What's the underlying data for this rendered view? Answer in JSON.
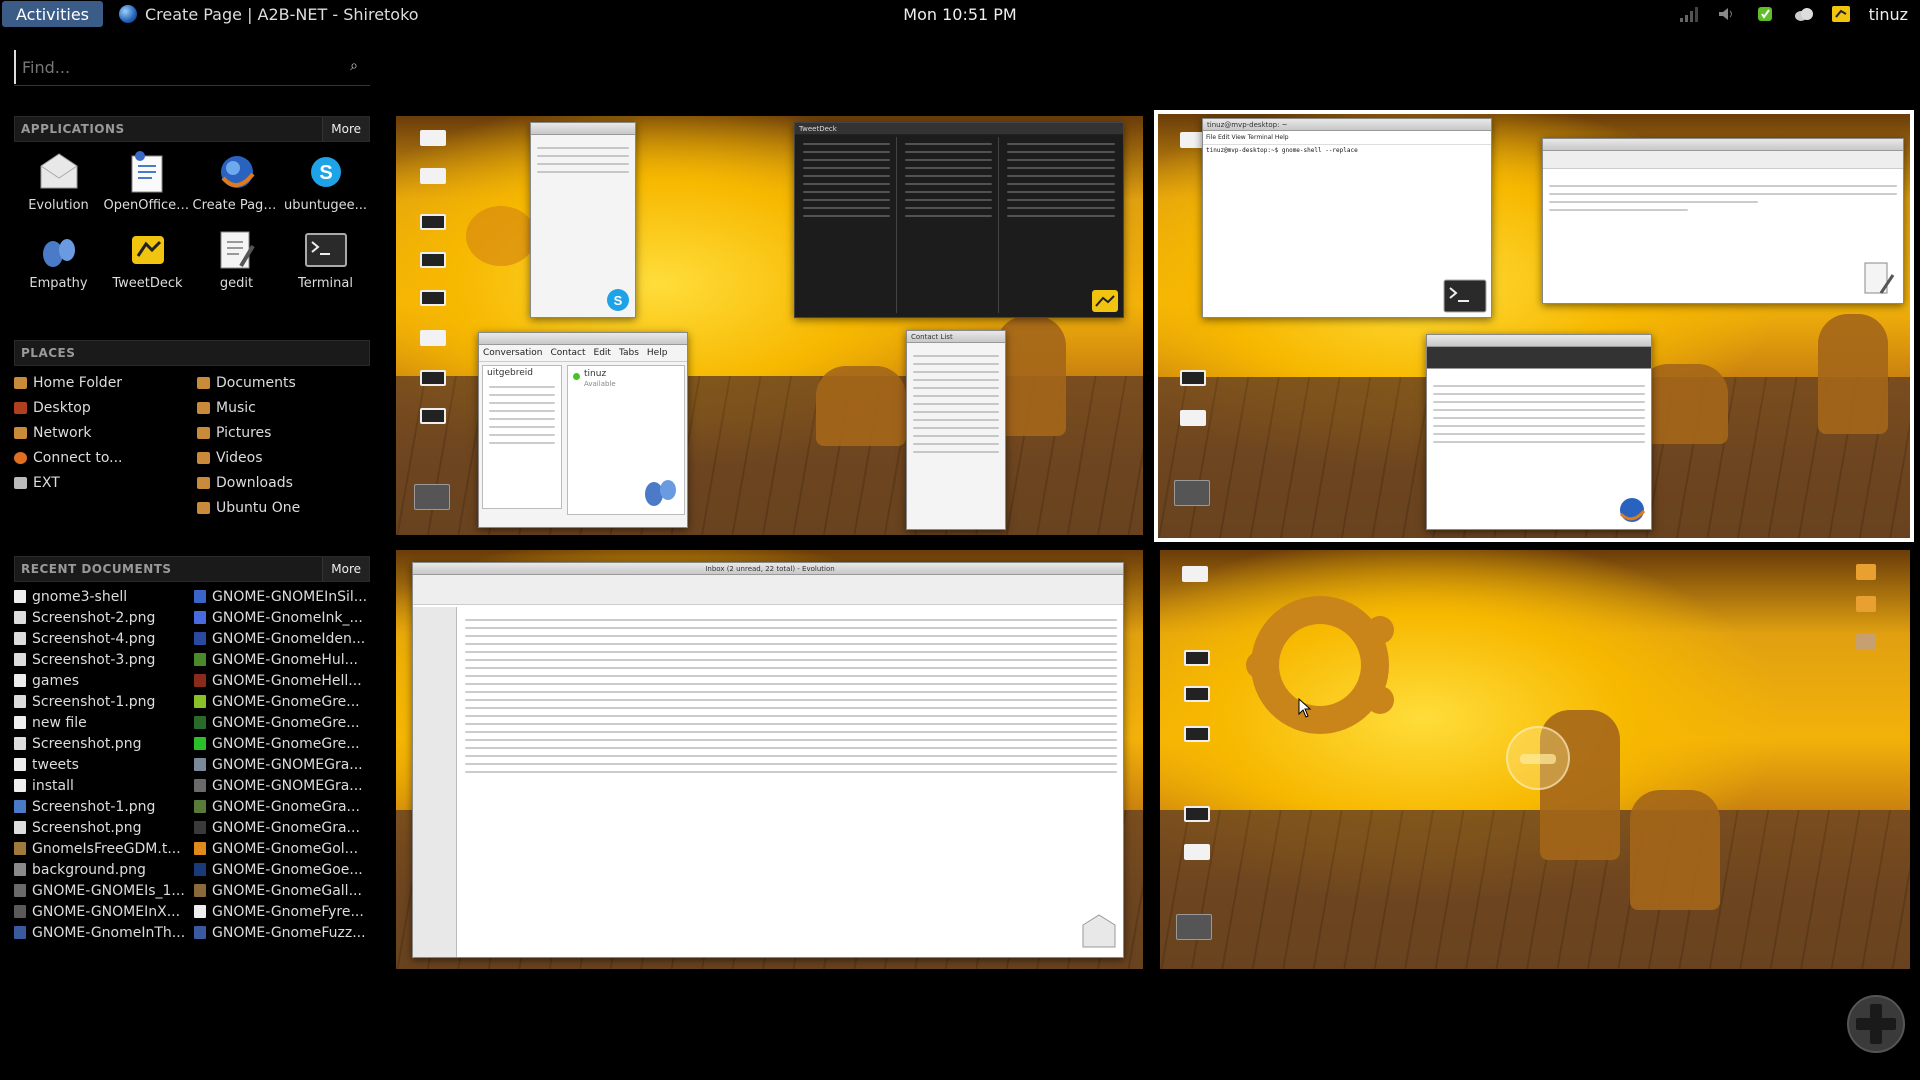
{
  "panel": {
    "activities": "Activities",
    "app_title": "Create Page | A2B-NET - Shiretoko",
    "clock": "Mon 10:51 PM",
    "user": "tinuz"
  },
  "search": {
    "placeholder": "Find..."
  },
  "applications": {
    "header": "APPLICATIONS",
    "more": "More",
    "items": [
      {
        "label": "Evolution",
        "icon": "evolution-icon"
      },
      {
        "label": "OpenOffice....",
        "icon": "openoffice-icon"
      },
      {
        "label": "Create Page...",
        "icon": "firefox-icon"
      },
      {
        "label": "ubuntugee...",
        "icon": "skype-icon"
      },
      {
        "label": "Empathy",
        "icon": "empathy-icon"
      },
      {
        "label": "TweetDeck",
        "icon": "tweetdeck-icon"
      },
      {
        "label": "gedit",
        "icon": "gedit-icon"
      },
      {
        "label": "Terminal",
        "icon": "terminal-icon"
      }
    ]
  },
  "places": {
    "header": "PLACES",
    "items": [
      {
        "label": "Home Folder",
        "color": "#c98a3a"
      },
      {
        "label": "Documents",
        "color": "#c98a3a"
      },
      {
        "label": "Desktop",
        "color": "#b04020"
      },
      {
        "label": "Music",
        "color": "#c98a3a"
      },
      {
        "label": "Network",
        "color": "#c98a3a"
      },
      {
        "label": "Pictures",
        "color": "#c98a3a"
      },
      {
        "label": "Connect to...",
        "color": "#e07020"
      },
      {
        "label": "Videos",
        "color": "#c98a3a"
      },
      {
        "label": "EXT",
        "color": "#bbbbbb"
      },
      {
        "label": "Downloads",
        "color": "#c98a3a"
      },
      {
        "label": "",
        "color": ""
      },
      {
        "label": "Ubuntu One",
        "color": "#c98a3a"
      }
    ]
  },
  "recent": {
    "header": "RECENT DOCUMENTS",
    "more": "More",
    "items": [
      {
        "label": "gnome3-shell",
        "color": "#eeeeee"
      },
      {
        "label": "GNOME-GNOMEInSil...",
        "color": "#3a66c8"
      },
      {
        "label": "Screenshot-2.png",
        "color": "#dddddd"
      },
      {
        "label": "GNOME-GnomeInk_...",
        "color": "#4a6ae0"
      },
      {
        "label": "Screenshot-4.png",
        "color": "#dddddd"
      },
      {
        "label": "GNOME-GnomeIden...",
        "color": "#2a4aa0"
      },
      {
        "label": "Screenshot-3.png",
        "color": "#dddddd"
      },
      {
        "label": "GNOME-GnomeHul...",
        "color": "#4a8a2a"
      },
      {
        "label": "games",
        "color": "#eeeeee"
      },
      {
        "label": "GNOME-GnomeHell...",
        "color": "#8a2a1a"
      },
      {
        "label": "Screenshot-1.png",
        "color": "#dddddd"
      },
      {
        "label": "GNOME-GnomeGre...",
        "color": "#8ac02a"
      },
      {
        "label": "new file",
        "color": "#eeeeee"
      },
      {
        "label": "GNOME-GnomeGre...",
        "color": "#2a6a2a"
      },
      {
        "label": "Screenshot.png",
        "color": "#dddddd"
      },
      {
        "label": "GNOME-GnomeGre...",
        "color": "#2ac02a"
      },
      {
        "label": "tweets",
        "color": "#eeeeee"
      },
      {
        "label": "GNOME-GNOMEGra...",
        "color": "#7a8a9a"
      },
      {
        "label": "install",
        "color": "#eeeeee"
      },
      {
        "label": "GNOME-GNOMEGra...",
        "color": "#6a6a6a"
      },
      {
        "label": "Screenshot-1.png",
        "color": "#4a7ac8"
      },
      {
        "label": "GNOME-GnomeGra...",
        "color": "#5a7a3a"
      },
      {
        "label": "Screenshot.png",
        "color": "#dddddd"
      },
      {
        "label": "GNOME-GnomeGra...",
        "color": "#3a3a3a"
      },
      {
        "label": "GnomeIsFreeGDM.t...",
        "color": "#a07a3a"
      },
      {
        "label": "GNOME-GnomeGol...",
        "color": "#e08a1a"
      },
      {
        "label": "background.png",
        "color": "#8a8a8a"
      },
      {
        "label": "GNOME-GnomeGoe...",
        "color": "#1a3a7a"
      },
      {
        "label": "GNOME-GNOMEIs_1...",
        "color": "#6a6a6a"
      },
      {
        "label": "GNOME-GnomeGall...",
        "color": "#8a6a3a"
      },
      {
        "label": "GNOME-GNOMEInX...",
        "color": "#5a5a5a"
      },
      {
        "label": "GNOME-GnomeFyre...",
        "color": "#eeeeee"
      },
      {
        "label": "GNOME-GnomeInTh...",
        "color": "#3a5aa0"
      },
      {
        "label": "GNOME-GnomeFuzz...",
        "color": "#3a5aa0"
      }
    ]
  },
  "ws1": {
    "empathy_menu": [
      "Conversation",
      "Contact",
      "Edit",
      "Tabs",
      "Help"
    ],
    "empathy_contact": "uitgebreid",
    "empathy_status_name": "tinuz",
    "empathy_status": "Available",
    "contact_list_title": "Contact List",
    "tweetdeck_title": "TweetDeck"
  },
  "ws2": {
    "terminal_title": "tinuz@mvp-desktop: ~",
    "terminal_line": "tinuz@mvp-desktop:~$ gnome-shell --replace"
  },
  "ws3": {
    "evolution_title": "Inbox (2 unread, 22 total) - Evolution"
  }
}
